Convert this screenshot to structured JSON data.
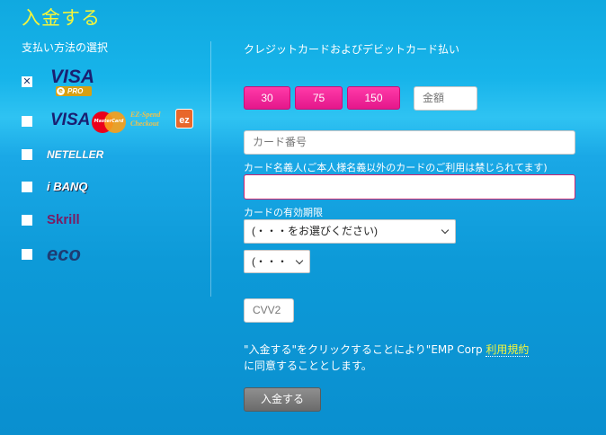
{
  "header": {
    "title": "入金する"
  },
  "sidebar": {
    "heading": "支払い方法の選択",
    "methods": [
      {
        "name": "visa-epro",
        "logo_text": "VISA",
        "sub_text": "PRO",
        "checked": true
      },
      {
        "name": "visa-mastercard-ezspend",
        "logo_text": "VISA",
        "mc_text": "MasterCard",
        "ez_text": "EZ-Spend",
        "ez_text2": "Checkout",
        "ez_badge": "ez",
        "checked": false
      },
      {
        "name": "neteller",
        "logo_text": "NETELLER",
        "checked": false
      },
      {
        "name": "ibanq",
        "logo_text": "i BANQ",
        "checked": false
      },
      {
        "name": "skrill",
        "logo_text": "Skrill",
        "checked": false
      },
      {
        "name": "eco",
        "logo_text": "eco",
        "checked": false
      }
    ],
    "check_mark": "✕"
  },
  "main": {
    "heading": "クレジットカードおよびデビットカード払い",
    "amounts": [
      "30",
      "75",
      "150"
    ],
    "amount_placeholder": "金額",
    "card_number_placeholder": "カード番号",
    "cardholder_label": "カード名義人(ご本人様名義以外のカードのご利用は禁じられてます)",
    "cardholder_value": "",
    "expiry_label": "カードの有効期限",
    "expiry_month_select": "(・・・をお選びください)",
    "expiry_year_select": "(・・・",
    "cvv_placeholder": "CVV2",
    "agreement_prefix": "\"入金する\"をクリックすることにより\"EMP Corp ",
    "agreement_link": "利用規約",
    "agreement_suffix": "に同意することとします。",
    "submit_label": "入金する"
  },
  "colors": {
    "accent_yellow": "#f5f53a",
    "amount_pink": "#e4178b",
    "visa_blue": "#1a1f71",
    "submit_gray": "#7b7b7b"
  }
}
